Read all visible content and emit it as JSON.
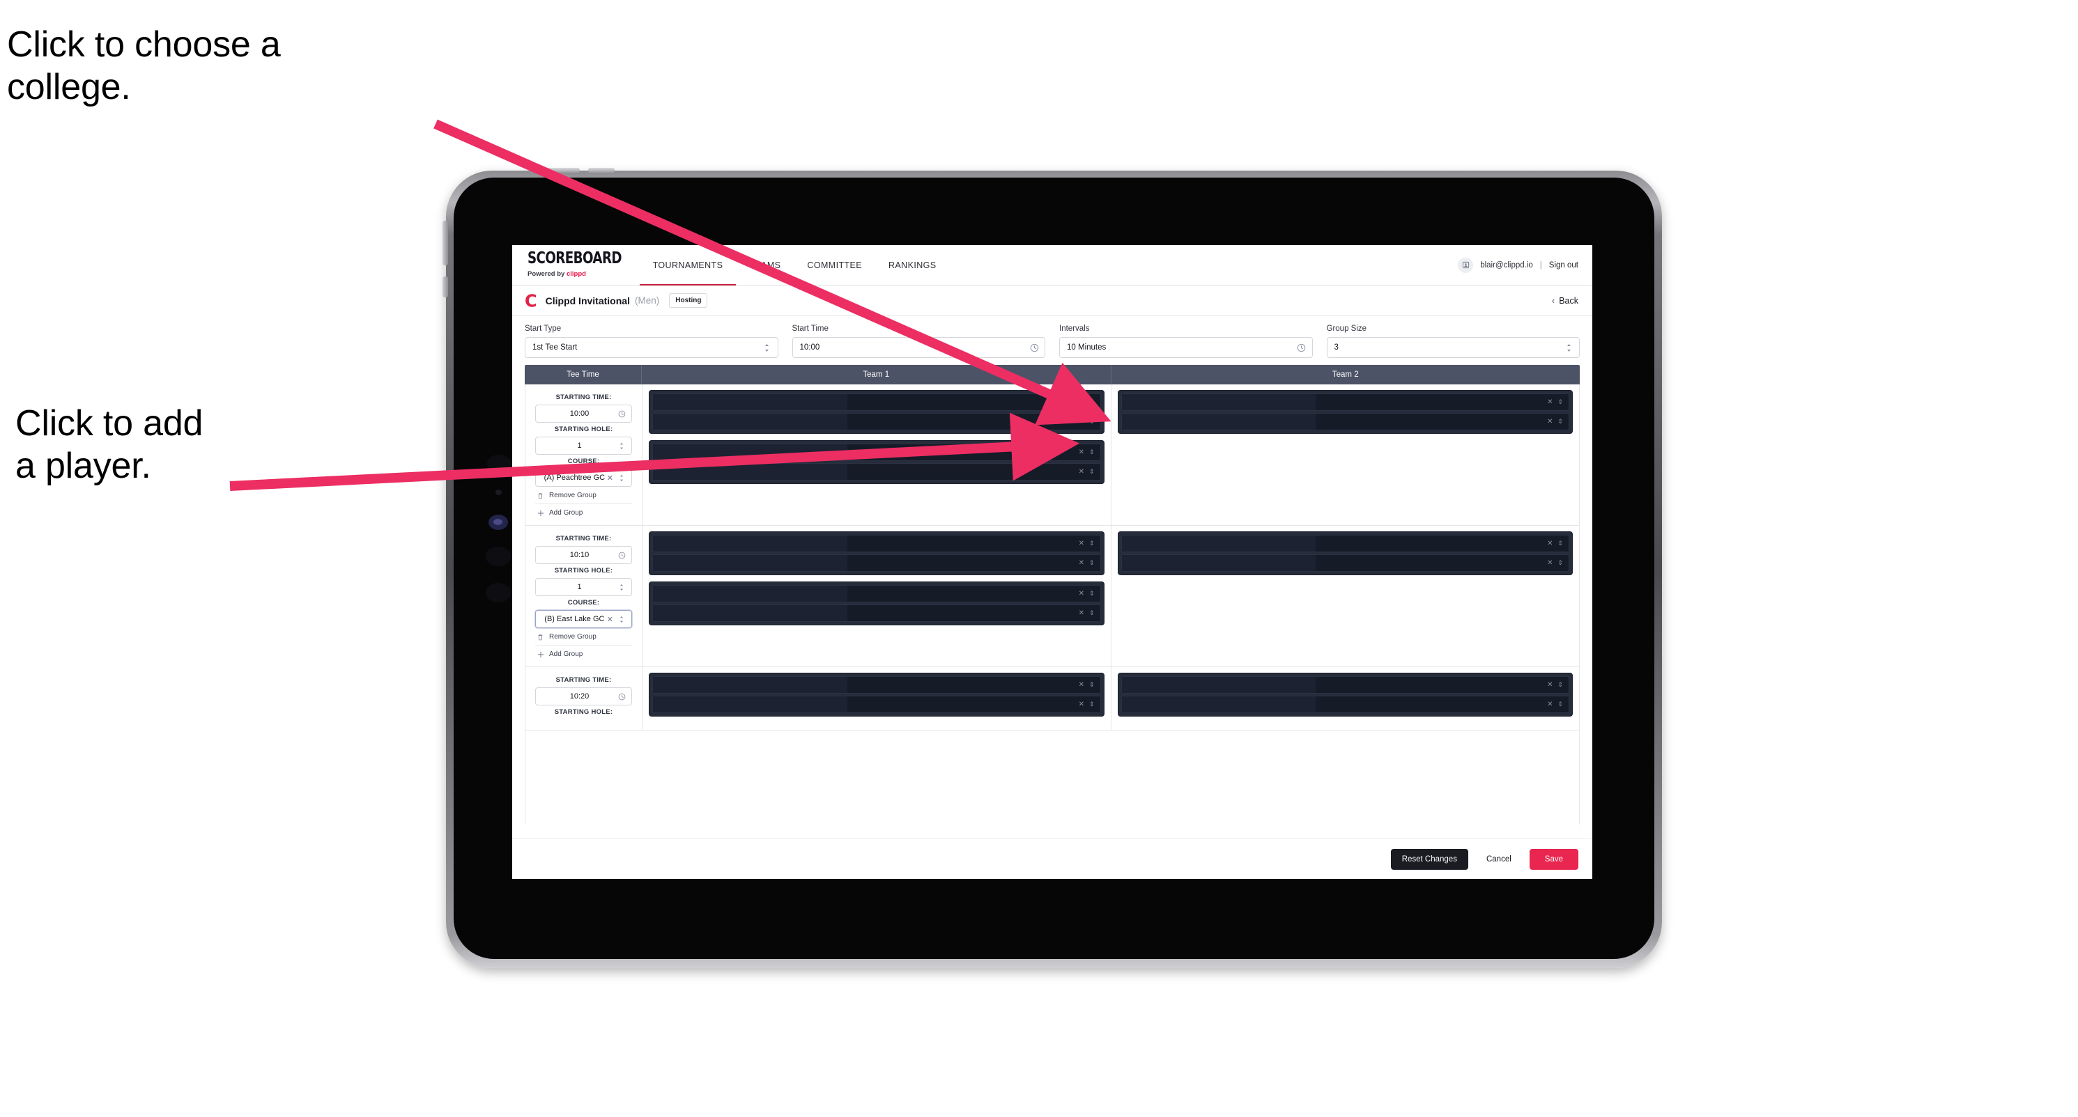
{
  "annotations": {
    "college": "Click to choose a\ncollege.",
    "player": "Click to add\na player.",
    "arrow_color": "#ec2e63"
  },
  "nav": {
    "brand_title": "SCOREBOARD",
    "brand_sub_prefix": "Powered by ",
    "brand_sub_name": "clippd",
    "tabs": [
      {
        "label": "TOURNAMENTS",
        "active": true
      },
      {
        "label": "TEAMS",
        "active": false
      },
      {
        "label": "COMMITTEE",
        "active": false
      },
      {
        "label": "RANKINGS",
        "active": false
      }
    ],
    "user_email": "blair@clippd.io",
    "separator": "|",
    "sign_out": "Sign out",
    "avatar_icon": "user-badge-icon"
  },
  "tournament_bar": {
    "logo_letter": "C",
    "name": "Clippd Invitational",
    "gender": "(Men)",
    "badge": "Hosting",
    "back_label": "Back",
    "back_icon": "chevron-left-icon"
  },
  "controls": [
    {
      "label": "Start Type",
      "value": "1st Tee Start",
      "icon": "stepper-icon"
    },
    {
      "label": "Start Time",
      "value": "10:00",
      "icon": "clock-icon"
    },
    {
      "label": "Intervals",
      "value": "10 Minutes",
      "icon": "clock-icon"
    },
    {
      "label": "Group Size",
      "value": "3",
      "icon": "stepper-icon"
    }
  ],
  "table": {
    "headers": {
      "tee_time": "Tee Time",
      "team1": "Team 1",
      "team2": "Team 2"
    },
    "labels": {
      "starting_time": "STARTING TIME:",
      "starting_hole": "STARTING HOLE:",
      "course": "COURSE:",
      "remove_group": "Remove Group",
      "add_group": "Add Group",
      "remove_icon": "trash-icon",
      "add_icon": "plus-icon",
      "clear_icon": "close-icon",
      "stepper_icon": "stepper-icon",
      "clock_icon": "clock-icon"
    },
    "rows": [
      {
        "starting_time": "10:00",
        "starting_hole": "1",
        "course": "(A) Peachtree GC",
        "course_focused": false,
        "team1_groups": [
          {
            "players": 2
          },
          {
            "players": 2
          }
        ],
        "team2_groups": [
          {
            "players": 2
          }
        ]
      },
      {
        "starting_time": "10:10",
        "starting_hole": "1",
        "course": "(B) East Lake GC",
        "course_focused": true,
        "team1_groups": [
          {
            "players": 2
          },
          {
            "players": 2
          }
        ],
        "team2_groups": [
          {
            "players": 2
          }
        ]
      },
      {
        "starting_time": "10:20",
        "starting_hole": "",
        "course": "",
        "course_focused": false,
        "team1_groups": [
          {
            "players": 2
          }
        ],
        "team2_groups": [
          {
            "players": 2
          }
        ]
      }
    ]
  },
  "footer": {
    "reset": "Reset Changes",
    "cancel": "Cancel",
    "save": "Save"
  },
  "colors": {
    "accent_pink": "#e8264f",
    "brand_red": "#e02347",
    "table_header": "#4d5366",
    "dark_block": "#262c3a"
  }
}
